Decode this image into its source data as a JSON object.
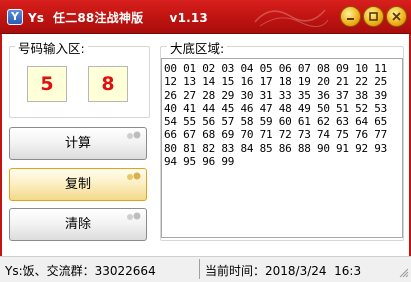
{
  "window": {
    "app_icon_letter": "Y",
    "title": "Ys  任二88注战神版      v1.13"
  },
  "left_panel": {
    "group_label": "号码输入区:",
    "number_a": "5",
    "number_b": "8"
  },
  "buttons": {
    "calc_label": "计算",
    "copy_label": "复制",
    "clear_label": "清除"
  },
  "right_panel": {
    "group_label": "大底区域:",
    "result_text": "00 01 02 03 04 05 06 07 08 09 10 11 12 13 14 15 16 17 18 19 20 21 22 25 26 27 28 29 30 31 33 35 36 37 38 39 40 41 44 45 46 47 48 49 50 51 52 53 54 55 56 57 58 59 60 61 62 63 64 65 66 67 68 69 70 71 72 73 74 75 76 77 80 81 82 83 84 85 86 88 90 91 92 93 94 95 96 99"
  },
  "status": {
    "left_text": "Ys:饭、交流群：33022664",
    "right_text": "当前时间：2018/3/24  16:3"
  },
  "colors": {
    "title_bar": "#c31512",
    "number_text": "#e01010",
    "number_bg": "#ffffd8",
    "copy_button_border": "#e3a21a"
  }
}
